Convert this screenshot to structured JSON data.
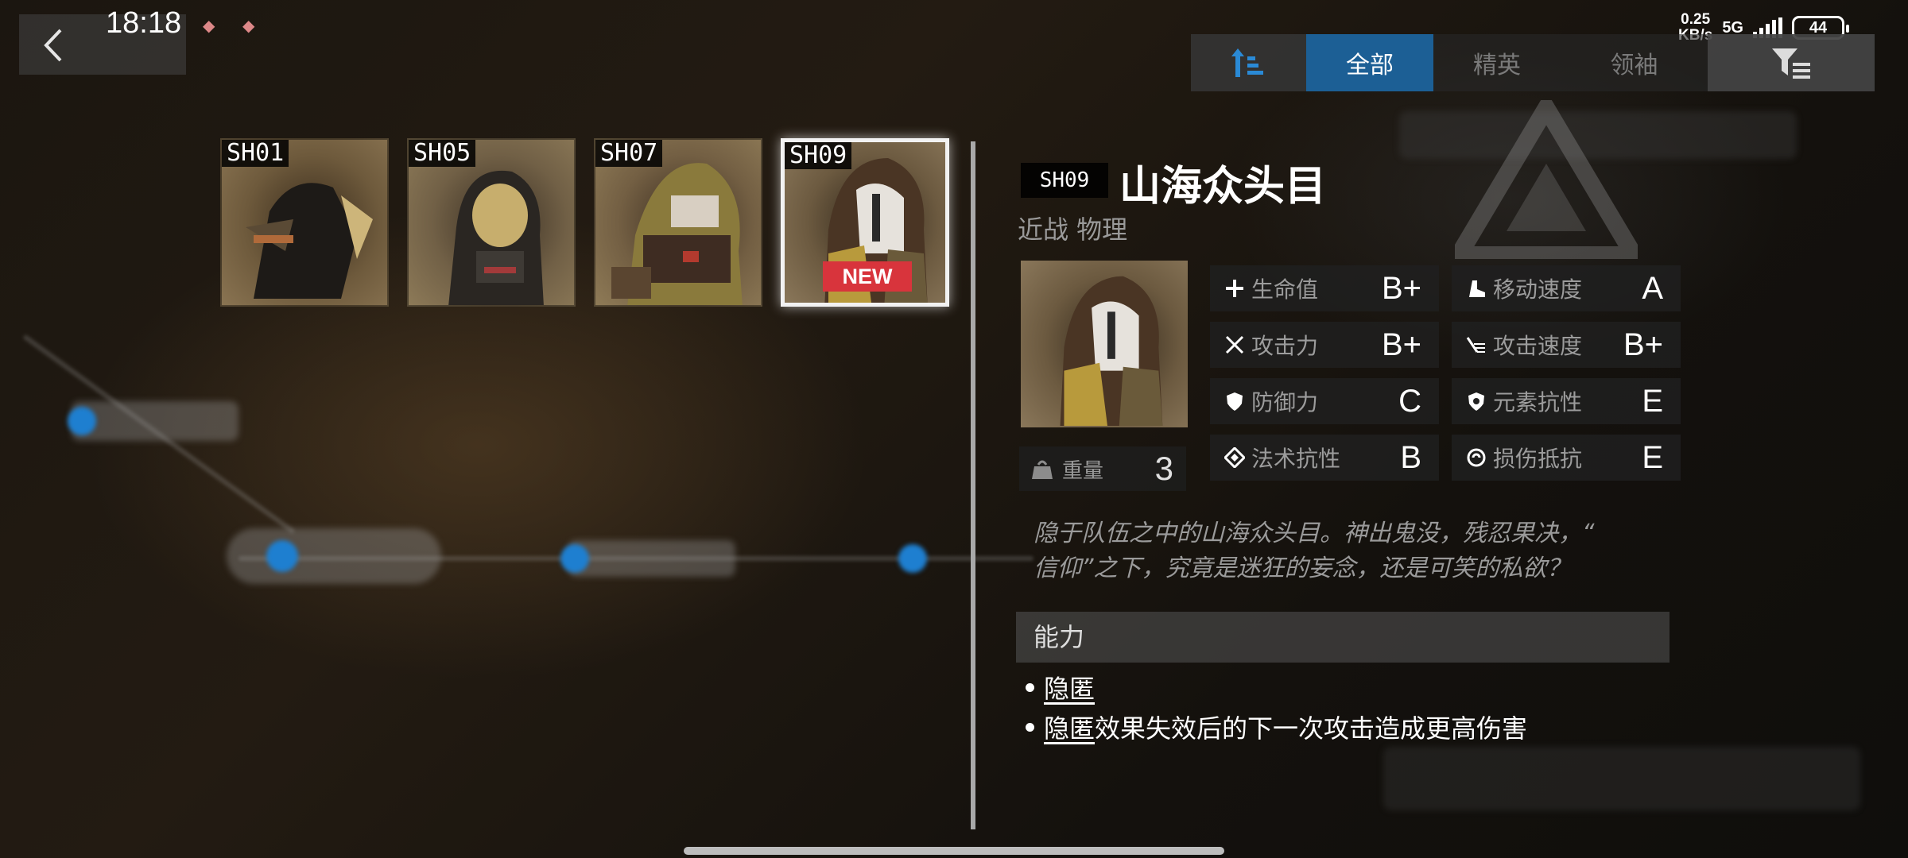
{
  "status_bar": {
    "time": "18:18",
    "net_speed_value": "0.25",
    "net_speed_unit": "KB/s",
    "network": "5G",
    "battery": "44"
  },
  "filter_tabs": {
    "all": "全部",
    "elite": "精英",
    "leader": "领袖",
    "selected": "全部"
  },
  "cards": [
    {
      "code": "SH01"
    },
    {
      "code": "SH05"
    },
    {
      "code": "SH07"
    },
    {
      "code": "SH09",
      "badge": "NEW",
      "selected": true
    }
  ],
  "detail": {
    "code": "SH09",
    "name": "山海众头目",
    "type": "近战 物理",
    "weight_label": "重量",
    "weight_value": "3",
    "stats": [
      {
        "icon": "plus-icon",
        "label": "生命值",
        "grade": "B+"
      },
      {
        "icon": "boot-icon",
        "label": "移动速度",
        "grade": "A"
      },
      {
        "icon": "crossed-swords-icon",
        "label": "攻击力",
        "grade": "B+"
      },
      {
        "icon": "speed-lines-icon",
        "label": "攻击速度",
        "grade": "B+"
      },
      {
        "icon": "shield-icon",
        "label": "防御力",
        "grade": "C"
      },
      {
        "icon": "element-shield-icon",
        "label": "元素抗性",
        "grade": "E"
      },
      {
        "icon": "diamond-icon",
        "label": "法术抗性",
        "grade": "B"
      },
      {
        "icon": "ring-icon",
        "label": "损伤抵抗",
        "grade": "E"
      }
    ],
    "description_line1": "隐于队伍之中的山海众头目。神出鬼没，残忍果决，“",
    "description_line2": "信仰”之下，究竟是迷狂的妄念，还是可笑的私欲？",
    "ability_title": "能力",
    "abilities": [
      {
        "keyword": "隐匿",
        "text": ""
      },
      {
        "keyword": "隐匿",
        "text": "效果失效后的下一次攻击造成更高伤害"
      }
    ]
  },
  "colors": {
    "accent_tab": "#1c5f95",
    "new_badge": "#d8343c"
  }
}
